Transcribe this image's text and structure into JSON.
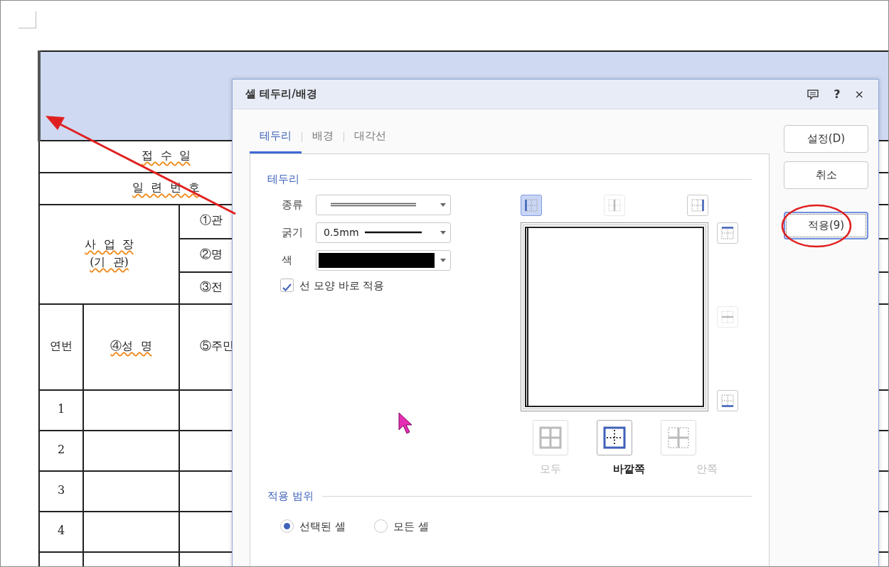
{
  "document": {
    "header_row": {
      "selected": true
    },
    "receipt_label": {
      "text": "접  수  일",
      "flagged": true
    },
    "serial_label": {
      "text": "일  련  번  호",
      "flagged": true
    },
    "workplace_label": {
      "lines": [
        "사  업  장",
        "(기  관)"
      ],
      "flagged": true
    },
    "workplace_fields": [
      "①관",
      "②명",
      "③전"
    ],
    "columns": [
      {
        "text": "연번",
        "flagged": false
      },
      {
        "text": "④성  명",
        "flagged": true
      },
      {
        "text": "⑤주민",
        "flagged": false
      }
    ],
    "row_numbers": [
      "1",
      "2",
      "3",
      "4"
    ]
  },
  "dialog": {
    "title": "셀 테두리/배경",
    "help": "?",
    "close": "×",
    "tabs": [
      {
        "label": "테두리",
        "selected": true
      },
      {
        "label": "배경",
        "selected": false
      },
      {
        "label": "대각선",
        "selected": false
      }
    ],
    "border_section": {
      "title": "테두리",
      "type": {
        "label": "종류",
        "kind": "double"
      },
      "thickness": {
        "label": "굵기",
        "value": "0.5mm"
      },
      "color": {
        "label": "색",
        "color": "#000000"
      },
      "apply_now": {
        "label": "선 모양 바로 적용",
        "checked": true
      }
    },
    "edge_buttons": [
      {
        "kind": "left",
        "selected": true,
        "disabled": false
      },
      {
        "kind": "inner_vertical",
        "selected": false,
        "disabled": true
      },
      {
        "kind": "right",
        "selected": false,
        "disabled": false
      },
      {
        "kind": "top",
        "selected": false,
        "disabled": false
      },
      {
        "kind": "inner_horizontal",
        "selected": false,
        "disabled": true
      },
      {
        "kind": "bottom",
        "selected": false,
        "disabled": false
      }
    ],
    "presets": [
      {
        "kind": "all",
        "label": "모두",
        "selected": false,
        "disabled": true
      },
      {
        "kind": "outer",
        "label": "바깥쪽",
        "selected": true,
        "disabled": false
      },
      {
        "kind": "inner",
        "label": "안쪽",
        "selected": false,
        "disabled": true
      }
    ],
    "scope": {
      "title": "적용 범위",
      "options": [
        {
          "label": "선택된 셀",
          "selected": true
        },
        {
          "label": "모든 셀",
          "selected": false
        }
      ]
    },
    "buttons": [
      {
        "label": "설정(D)",
        "focused": false
      },
      {
        "label": "취소",
        "focused": false
      },
      {
        "label": "적용(9)",
        "focused": true
      }
    ]
  }
}
